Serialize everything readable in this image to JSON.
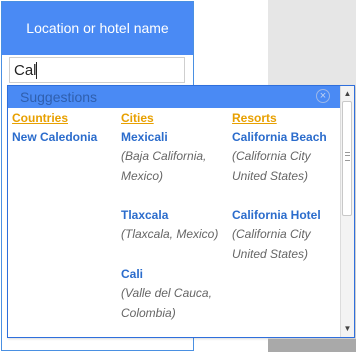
{
  "header": {
    "title": "Location or hotel name"
  },
  "search": {
    "value": "Cal"
  },
  "suggestions": {
    "title": "Suggestions",
    "close_glyph": "×",
    "columns": [
      {
        "heading": "Countries",
        "items": [
          {
            "name": "New Caledonia",
            "detail": ""
          }
        ]
      },
      {
        "heading": "Cities",
        "items": [
          {
            "name": "Mexicali",
            "detail": "(Baja California, Mexico)"
          },
          {
            "name": "Tlaxcala",
            "detail": "(Tlaxcala, Mexico)"
          },
          {
            "name": "Cali",
            "detail": "(Valle del Cauca, Colombia)"
          }
        ]
      },
      {
        "heading": "Resorts",
        "items": [
          {
            "name": "California Beach",
            "detail": "(California City United States)"
          },
          {
            "name": "California Hotel",
            "detail": "(California City United States)"
          }
        ]
      }
    ]
  },
  "scrollbar": {
    "up_glyph": "▲",
    "down_glyph": "▼"
  },
  "colors": {
    "accent": "#4a8af4",
    "heading": "#e8a000",
    "link": "#2b6ccc",
    "detail": "#666666"
  }
}
